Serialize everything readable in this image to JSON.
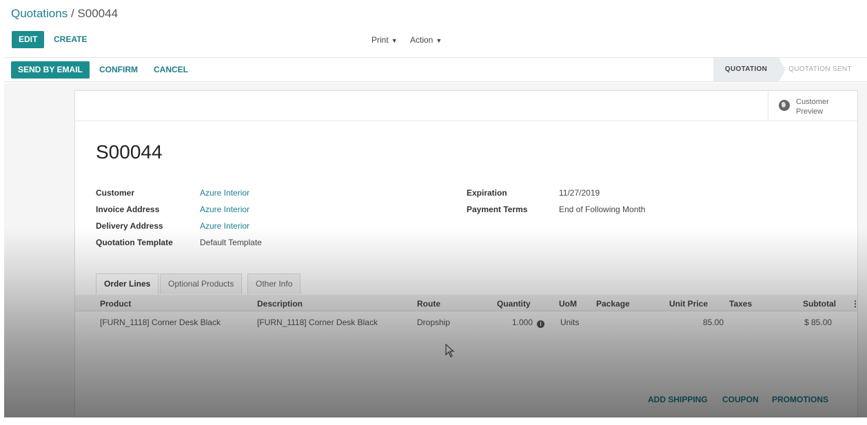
{
  "breadcrumb": {
    "parent": "Quotations",
    "separator": " / ",
    "current": "S00044"
  },
  "toolbar": {
    "edit": "EDIT",
    "create": "CREATE",
    "print": "Print",
    "action": "Action"
  },
  "statusbar": {
    "send_by_email": "SEND BY EMAIL",
    "confirm": "CONFIRM",
    "cancel": "CANCEL",
    "stages": [
      "QUOTATION",
      "QUOTATION SENT"
    ],
    "active_stage": "QUOTATION"
  },
  "button_box": {
    "customer_preview_line1": "Customer",
    "customer_preview_line2": "Preview"
  },
  "record": {
    "name": "S00044",
    "left_fields": [
      {
        "label": "Customer",
        "value": "Azure Interior",
        "link": true
      },
      {
        "label": "Invoice Address",
        "value": "Azure Interior",
        "link": true
      },
      {
        "label": "Delivery Address",
        "value": "Azure Interior",
        "link": true
      },
      {
        "label": "Quotation Template",
        "value": "Default Template",
        "link": false
      }
    ],
    "right_fields": [
      {
        "label": "Expiration",
        "value": "11/27/2019"
      },
      {
        "label": "Payment Terms",
        "value": "End of Following Month"
      }
    ]
  },
  "tabs": [
    "Order Lines",
    "Optional Products",
    "Other Info"
  ],
  "order_lines": {
    "columns": [
      "Product",
      "Description",
      "Route",
      "Quantity",
      "UoM",
      "Package",
      "Unit Price",
      "Taxes",
      "Subtotal"
    ],
    "rows": [
      {
        "product": "[FURN_1118] Corner Desk Black",
        "description": "[FURN_1118] Corner Desk Black",
        "route": "Dropship",
        "quantity": "1.000",
        "uom": "Units",
        "package": "",
        "unit_price": "85.00",
        "taxes": "",
        "subtotal": "$ 85.00"
      }
    ]
  },
  "footer_actions": [
    "ADD SHIPPING",
    "COUPON",
    "PROMOTIONS"
  ],
  "colors": {
    "primary": "#1c8d8e",
    "link": "#1f7e8e"
  }
}
